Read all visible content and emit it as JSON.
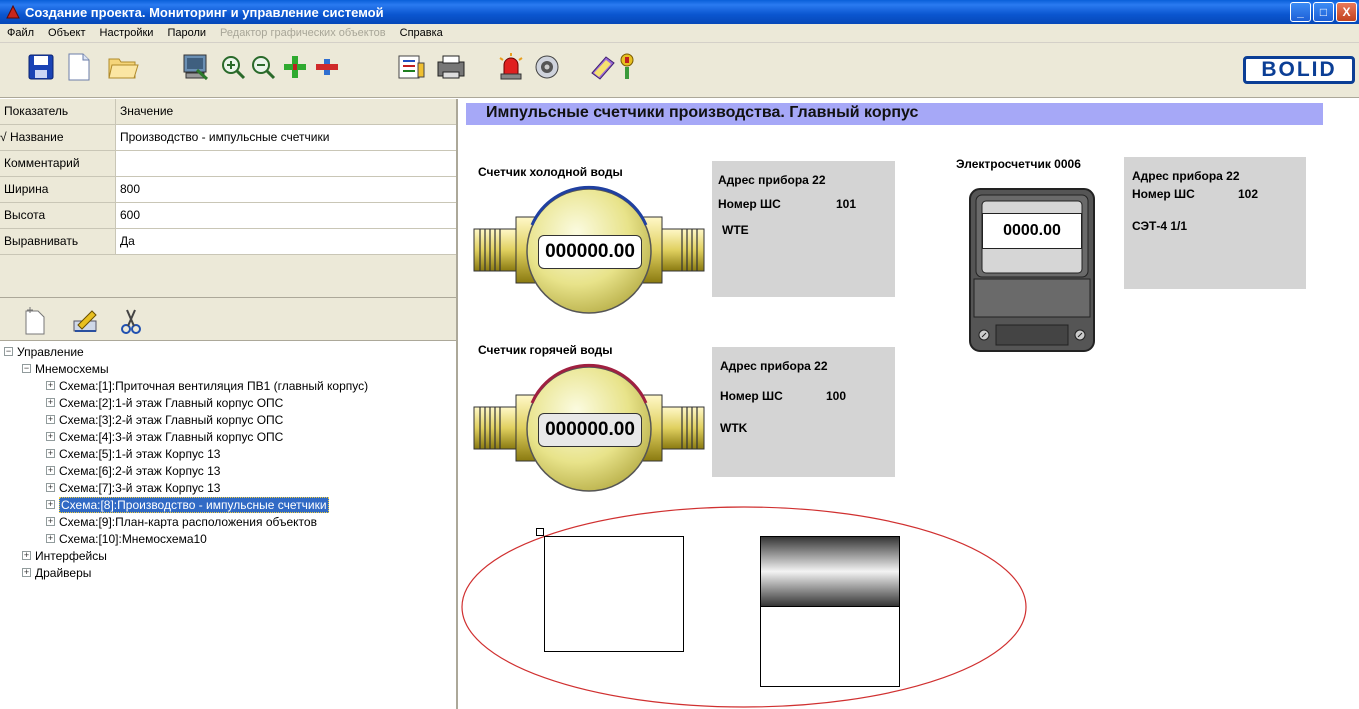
{
  "window": {
    "title": "Создание проекта. Мониторинг и управление системой",
    "buttons": {
      "minimize": "_",
      "maximize": "□",
      "close": "X"
    }
  },
  "menu": [
    "Файл",
    "Объект",
    "Настройки",
    "Пароли",
    "Редактор графических объектов",
    "Справка"
  ],
  "menu_disabled": [
    false,
    false,
    false,
    false,
    true,
    false
  ],
  "logo": "BOLID",
  "props": {
    "col_key": "Показатель",
    "col_value": "Значение",
    "rows": [
      {
        "k": "Название",
        "v": "Производство - импульсные счетчики",
        "check": "√"
      },
      {
        "k": "Комментарий",
        "v": ""
      },
      {
        "k": "Ширина",
        "v": "800"
      },
      {
        "k": "Высота",
        "v": "600"
      },
      {
        "k": "Выравнивать",
        "v": "Да"
      }
    ]
  },
  "tree": {
    "root": "Управление",
    "group": "Мнемосхемы",
    "items": [
      "Схема:[1]:Приточная вентиляция ПВ1 (главный корпус)",
      "Схема:[2]:1-й этаж Главный корпус ОПС",
      "Схема:[3]:2-й этаж Главный корпус ОПС",
      "Схема:[4]:3-й этаж Главный корпус ОПС",
      "Схема:[5]:1-й этаж Корпус 13",
      "Схема:[6]:2-й этаж Корпус 13",
      "Схема:[7]:3-й этаж Корпус 13",
      "Схема:[8]:Производство - импульсные счетчики",
      "Схема:[9]:План-карта расположения объектов",
      "Схема:[10]:Мнемосхема10"
    ],
    "selected_index": 7,
    "others": [
      "Интерфейсы",
      "Драйверы"
    ]
  },
  "canvas": {
    "header": "Импульсные счетчики производства. Главный корпус",
    "cold": {
      "label": "Счетчик холодной воды",
      "reading": "000000.00",
      "address": "Адрес прибора 22",
      "shc_label": "Номер ШС",
      "shc_value": "101",
      "code": "WTE"
    },
    "hot": {
      "label": "Счетчик горячей воды",
      "reading": "000000.00",
      "address": "Адрес прибора 22",
      "shc_label": "Номер ШС",
      "shc_value": "100",
      "code": "WTK"
    },
    "elec": {
      "label": "Электросчетчик 0006",
      "reading": "0000.00",
      "address": "Адрес прибора 22",
      "shc_label": "Номер ШС",
      "shc_value": "102",
      "code": "СЭТ-4 1/1"
    }
  },
  "colors": {
    "title_bar": "#0b56d0",
    "header_band": "#a6a8f7",
    "selection": "#316ac5",
    "ellipse": "#d03030"
  }
}
